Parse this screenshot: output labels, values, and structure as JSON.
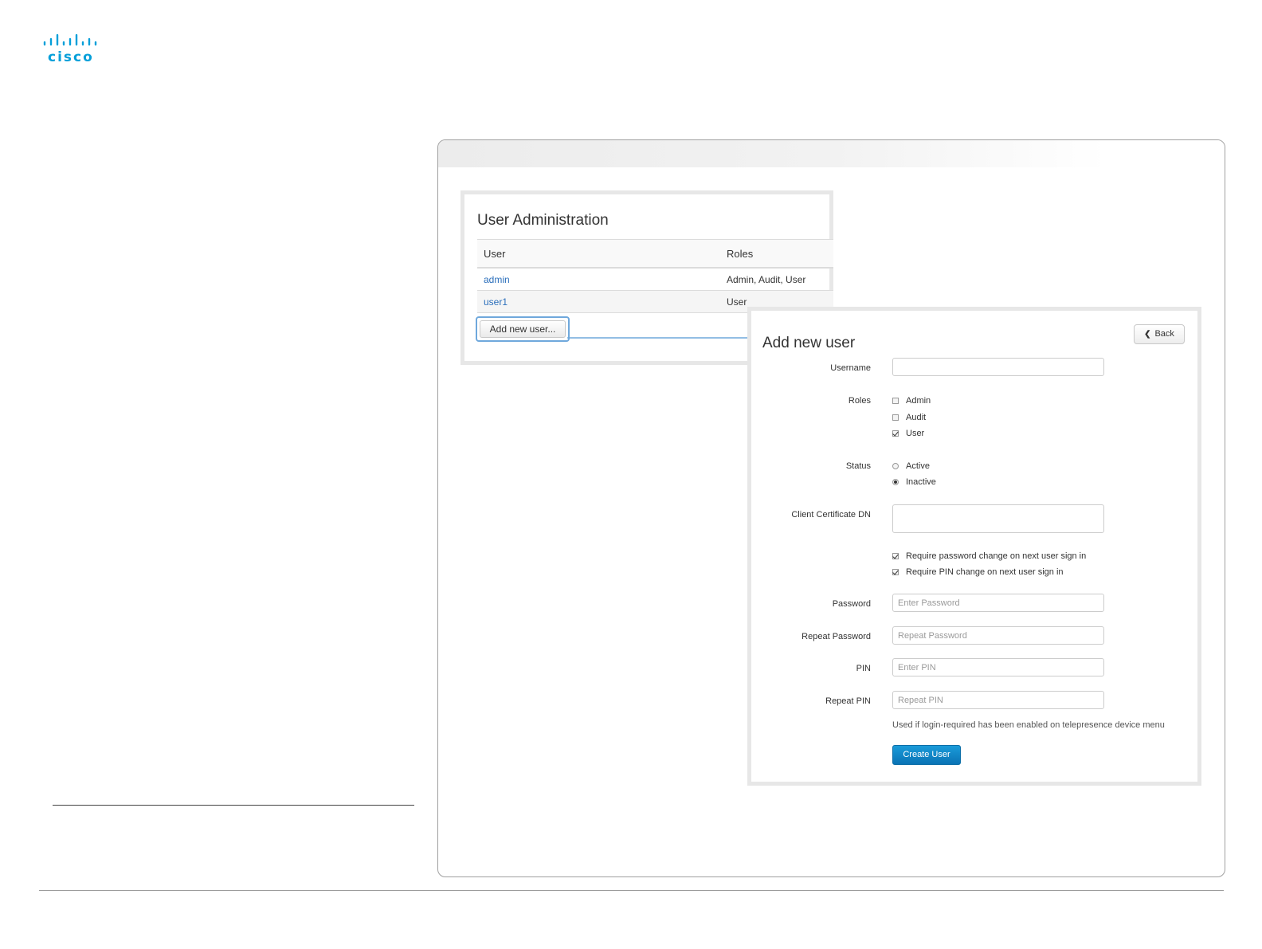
{
  "brand": {
    "logo_text": "cisco",
    "color": "#049fd9"
  },
  "user_admin": {
    "title": "User Administration",
    "columns": [
      "User",
      "Roles"
    ],
    "rows": [
      {
        "user": "admin",
        "roles": "Admin, Audit, User"
      },
      {
        "user": "user1",
        "roles": "User"
      }
    ],
    "add_button": "Add new user..."
  },
  "new_user": {
    "title": "Add new user",
    "back_label": "Back",
    "labels": {
      "username": "Username",
      "roles": "Roles",
      "status": "Status",
      "client_cert": "Client Certificate DN",
      "password": "Password",
      "repeat_password": "Repeat Password",
      "pin": "PIN",
      "repeat_pin": "Repeat PIN"
    },
    "roles": [
      {
        "label": "Admin",
        "checked": false
      },
      {
        "label": "Audit",
        "checked": false
      },
      {
        "label": "User",
        "checked": true
      }
    ],
    "status": [
      {
        "label": "Active",
        "selected": false
      },
      {
        "label": "Inactive",
        "selected": true
      }
    ],
    "options": [
      {
        "label": "Require password change on next user sign in",
        "checked": true
      },
      {
        "label": "Require PIN change on next user sign in",
        "checked": true
      }
    ],
    "placeholders": {
      "password": "Enter Password",
      "repeat_password": "Repeat Password",
      "pin": "Enter PIN",
      "repeat_pin": "Repeat PIN"
    },
    "help_text": "Used if login-required has been enabled on telepresence device menu",
    "create_button": "Create User",
    "accent_color": "#0a73b5"
  }
}
